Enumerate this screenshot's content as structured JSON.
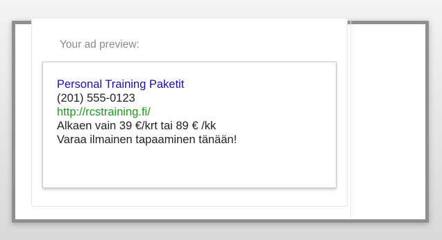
{
  "preview": {
    "label": "Your ad preview:"
  },
  "ad": {
    "title": "Personal Training Paketit",
    "phone": "(201) 555-0123",
    "url": "http://rcstraining.fi/",
    "description_line1": "Alkaen vain 39 €/krt tai 89 € /kk",
    "description_line2": "Varaa ilmainen tapaaminen tänään!"
  },
  "colors": {
    "title": "#1a0dab",
    "url": "#1a9b1a",
    "text": "#222222",
    "label": "#8a8a8a"
  }
}
